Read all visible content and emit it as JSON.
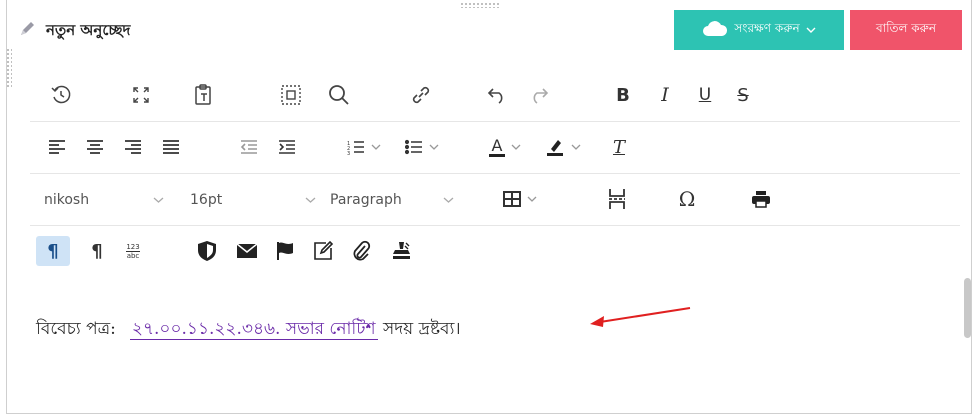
{
  "header": {
    "title": "নতুন অনুচ্ছেদ",
    "save_label": "সংরক্ষণ করুন",
    "cancel_label": "বাতিল করুন"
  },
  "toolbar": {
    "font_family": "nikosh",
    "font_size": "16pt",
    "block_format": "Paragraph",
    "bold": "B",
    "italic": "I",
    "underline": "U",
    "strike": "S",
    "text_color_letter": "A",
    "clear_format_letter": "T",
    "omega": "Ω",
    "numbering_badge_top": "123",
    "numbering_badge_bottom": "abc",
    "ltr_mark": "¶",
    "rtl_mark": "¶"
  },
  "content": {
    "prefix": "বিবেচ্য পত্র:",
    "link_text": "২৭.০০.১১.২২.৩৪৬. সভার নোটিশ",
    "suffix": "সদয় দ্রষ্টব্য।"
  },
  "colors": {
    "save": "#2dc3b3",
    "cancel": "#f0546a",
    "link": "#6a2aa8",
    "arrow": "#e02020"
  },
  "icons": [
    "pencil-icon",
    "cloud-icon",
    "history-icon",
    "fullscreen-icon",
    "paste-text-icon",
    "select-all-icon",
    "search-icon",
    "link-icon",
    "undo-icon",
    "redo-icon",
    "bold-icon",
    "italic-icon",
    "underline-icon",
    "strikethrough-icon",
    "align-left-icon",
    "align-center-icon",
    "align-right-icon",
    "justify-icon",
    "outdent-icon",
    "indent-icon",
    "numbered-list-icon",
    "bullet-list-icon",
    "text-color-icon",
    "highlight-icon",
    "clear-format-icon",
    "table-icon",
    "page-break-icon",
    "omega-icon",
    "print-icon",
    "shield-icon",
    "envelope-icon",
    "flag-icon",
    "edit-icon",
    "paperclip-icon",
    "stamp-icon"
  ]
}
